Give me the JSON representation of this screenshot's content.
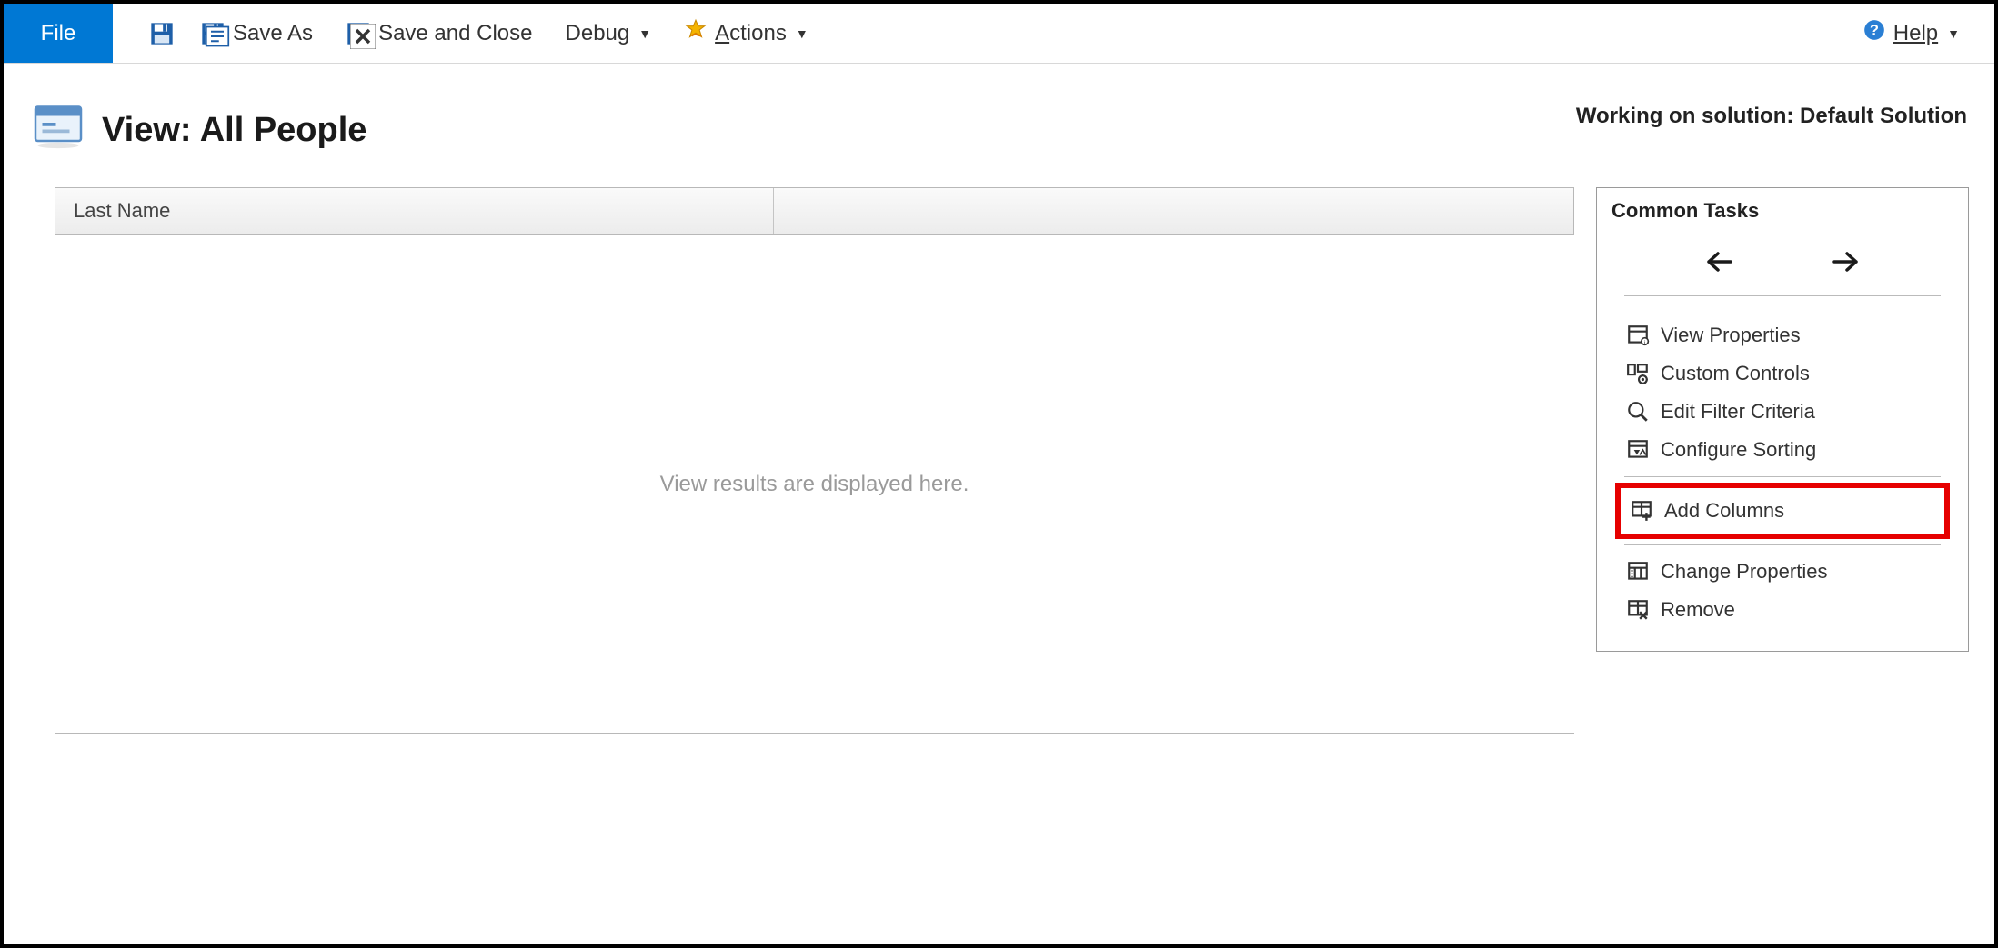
{
  "toolbar": {
    "file": "File",
    "save_as": "Save As",
    "save_close": "Save and Close",
    "debug": "Debug",
    "actions": "Actions",
    "help": "Help"
  },
  "header": {
    "title": "View: All People",
    "solution": "Working on solution: Default Solution"
  },
  "grid": {
    "columns": [
      "Last Name"
    ],
    "placeholder": "View results are displayed here."
  },
  "tasks": {
    "title": "Common Tasks",
    "items": {
      "view_properties": "View Properties",
      "custom_controls": "Custom Controls",
      "edit_filter": "Edit Filter Criteria",
      "configure_sorting": "Configure Sorting",
      "add_columns": "Add Columns",
      "change_properties": "Change Properties",
      "remove": "Remove"
    }
  }
}
